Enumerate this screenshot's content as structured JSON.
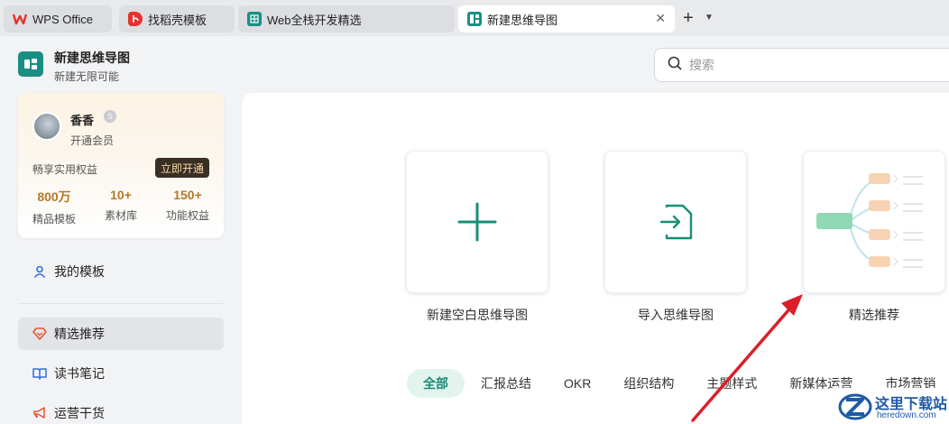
{
  "tabs": [
    {
      "label": "WPS Office",
      "icon": "wps-logo-icon",
      "color": "#e5322d"
    },
    {
      "label": "找稻壳模板",
      "icon": "docer-icon",
      "color": "#e5322d"
    },
    {
      "label": "Web全栈开发精选",
      "icon": "spreadsheet-doc-icon",
      "color": "#1b8e84"
    },
    {
      "label": "新建思维导图",
      "icon": "mindmap-doc-icon",
      "color": "#1b8e84",
      "active": true
    }
  ],
  "app": {
    "title": "新建思维导图",
    "subtitle": "新建无限可能"
  },
  "user": {
    "name": "香香",
    "member": "开通会员",
    "benefit_text": "畅享实用权益",
    "open_button": "立即开通",
    "stats": [
      {
        "value": "800万",
        "label": "精品模板"
      },
      {
        "value": "10+",
        "label": "素材库"
      },
      {
        "value": "150+",
        "label": "功能权益"
      }
    ]
  },
  "nav": [
    {
      "label": "我的模板",
      "icon": "user-icon"
    },
    {
      "label": "精选推荐",
      "icon": "diamond-icon",
      "active": true
    },
    {
      "label": "读书笔记",
      "icon": "book-icon"
    },
    {
      "label": "运营干货",
      "icon": "megaphone-icon"
    }
  ],
  "search": {
    "placeholder": "搜索"
  },
  "cards": [
    {
      "label": "新建空白思维导图",
      "icon": "plus-icon"
    },
    {
      "label": "导入思维导图",
      "icon": "import-file-icon"
    },
    {
      "label": "精选推荐",
      "icon": "mindmap-preview"
    }
  ],
  "filters": [
    "全部",
    "汇报总结",
    "OKR",
    "组织结构",
    "主题样式",
    "新媒体运营",
    "市场营销"
  ],
  "watermark": {
    "text": "这里下载站",
    "url": "heredown.com"
  },
  "colors": {
    "accent": "#1a8d77",
    "vip_gold": "#b5782a",
    "arrow": "#d9202a"
  }
}
